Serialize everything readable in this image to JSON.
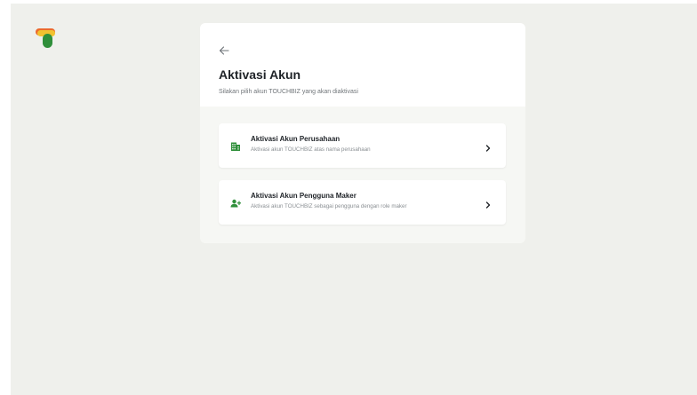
{
  "brand": {
    "logo_icon": "touchbiz-logo",
    "colors": {
      "green": "#2f8f3a",
      "yellow": "#f2c230",
      "orange": "#ec6a2c",
      "dark": "#1f2328"
    }
  },
  "header": {
    "back_icon": "arrow-left-icon",
    "title": "Aktivasi Akun",
    "subtitle": "Silakan pilih akun TOUCHBIZ yang akan diaktivasi"
  },
  "options": [
    {
      "icon": "company-building-icon",
      "title": "Aktivasi Akun Perusahaan",
      "description": "Aktivasi akun TOUCHBIZ atas nama perusahaan",
      "chevron_icon": "chevron-right-icon"
    },
    {
      "icon": "user-add-icon",
      "title": "Aktivasi Akun Pengguna Maker",
      "description": "Aktivasi akun TOUCHBIZ sebagai pengguna dengan role maker",
      "chevron_icon": "chevron-right-icon"
    }
  ]
}
